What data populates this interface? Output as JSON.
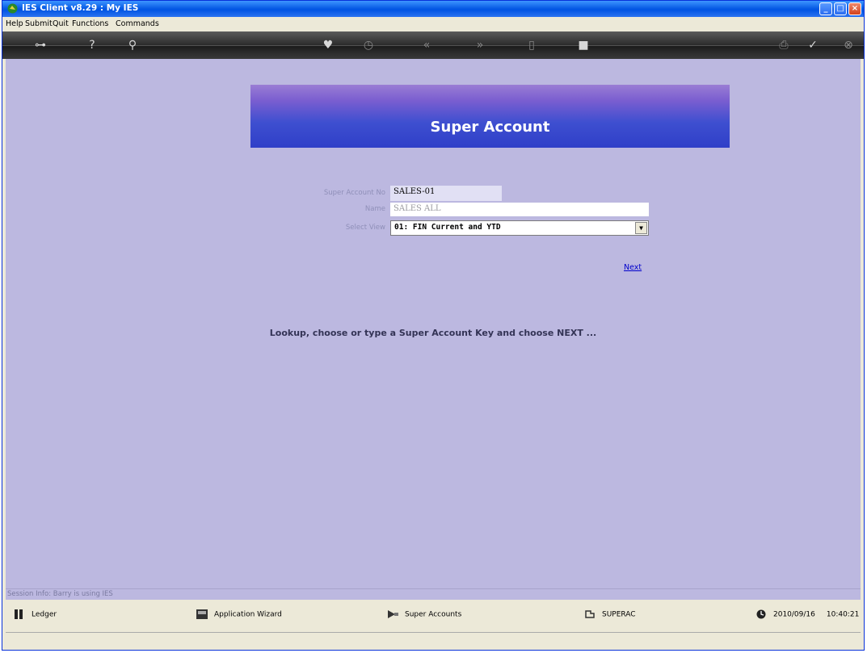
{
  "window": {
    "title": "IES Client v8.29 : My IES"
  },
  "menu": [
    "Help",
    "Submit",
    "Quit",
    "Functions",
    "Commands"
  ],
  "toolbar_icons": [
    "key-icon",
    "help-icon",
    "search-icon",
    "heart-icon",
    "clock-icon",
    "rewind-icon",
    "forward-icon",
    "bookmark-icon",
    "stop-icon",
    "print-icon",
    "check-icon",
    "close-icon"
  ],
  "banner": {
    "title": "Super Account"
  },
  "form": {
    "super_account_no_label": "Super Account No",
    "super_account_no_value": "SALES-01",
    "name_label": "Name",
    "name_value": "SALES ALL",
    "select_view_label": "Select View",
    "select_view_value": "01: FIN Current and YTD"
  },
  "next_link": "Next",
  "instruction": "Lookup, choose or type a Super Account  Key and choose NEXT ...",
  "session": "Session Info: Barry is using IES",
  "taskbar": {
    "ledger": "Ledger",
    "wizard": "Application Wizard",
    "super_accounts": "Super Accounts",
    "superac": "SUPERAC",
    "date": "2010/09/16",
    "time": "10:40:21"
  }
}
